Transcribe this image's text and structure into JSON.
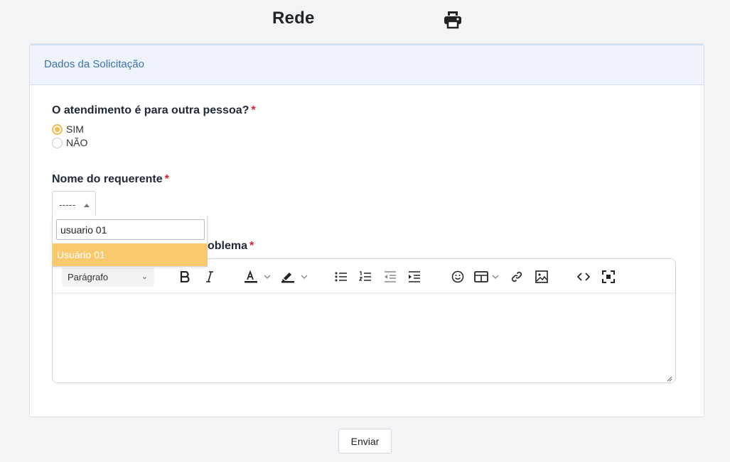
{
  "page": {
    "title": "Rede",
    "print_icon": "printer-icon"
  },
  "card": {
    "header_title": "Dados da Solicitação"
  },
  "question": {
    "label": "O atendimento é para outra pessoa?",
    "required_mark": "*",
    "options": [
      {
        "label": "SIM",
        "checked": true
      },
      {
        "label": "NÃO",
        "checked": false
      }
    ]
  },
  "requester": {
    "label": "Nome do requerente",
    "required_mark": "*",
    "selected_value": "-----",
    "search_value": "usuario 01",
    "results": [
      "Usuário 01"
    ]
  },
  "problem": {
    "label_visible": "oblema",
    "required_mark": "*"
  },
  "editor": {
    "block_format": "Parágrafo",
    "tools": [
      "bold-icon",
      "italic-icon",
      "text-color-icon",
      "highlight-icon",
      "bullet-list-icon",
      "numbered-list-icon",
      "outdent-icon",
      "indent-icon",
      "emoji-icon",
      "table-icon",
      "link-icon",
      "image-icon",
      "code-icon",
      "fullscreen-icon"
    ],
    "content": ""
  },
  "submit": {
    "label": "Enviar"
  },
  "colors": {
    "accent": "#f5b94c",
    "highlight": "#f9c96b",
    "link_blue": "#3a72b5",
    "required_red": "#d61f2c"
  }
}
